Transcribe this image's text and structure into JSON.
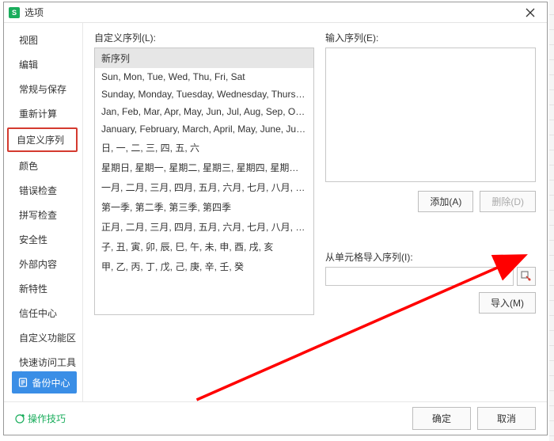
{
  "titlebar": {
    "title": "选项",
    "app_icon_letter": "S"
  },
  "sidebar": {
    "items": [
      {
        "label": "视图"
      },
      {
        "label": "编辑"
      },
      {
        "label": "常规与保存"
      },
      {
        "label": "重新计算"
      },
      {
        "label": "自定义序列"
      },
      {
        "label": "颜色"
      },
      {
        "label": "错误检查"
      },
      {
        "label": "拼写检查"
      },
      {
        "label": "安全性"
      },
      {
        "label": "外部内容"
      },
      {
        "label": "新特性"
      },
      {
        "label": "信任中心"
      },
      {
        "label": "自定义功能区"
      },
      {
        "label": "快速访问工具栏"
      }
    ],
    "selected_index": 4,
    "backup_label": "备份中心"
  },
  "content": {
    "custom_list_label": "自定义序列(L):",
    "custom_list": [
      "新序列",
      "Sun, Mon, Tue, Wed, Thu, Fri, Sat",
      "Sunday, Monday, Tuesday, Wednesday, Thursday, Frid...",
      "Jan, Feb, Mar, Apr, May, Jun, Jul, Aug, Sep, Oct, Nov, ...",
      "January, February, March, April, May, June, July, Augus...",
      "日, 一, 二, 三, 四, 五, 六",
      "星期日, 星期一, 星期二, 星期三, 星期四, 星期五, 星期六",
      "一月, 二月, 三月, 四月, 五月, 六月, 七月, 八月, 九月, 十月, ...",
      "第一季, 第二季, 第三季, 第四季",
      "正月, 二月, 三月, 四月, 五月, 六月, 七月, 八月, 九月, 十月, ...",
      "子, 丑, 寅, 卯, 辰, 巳, 午, 未, 申, 酉, 戌, 亥",
      "甲, 乙, 丙, 丁, 戊, 己, 庚, 辛, 壬, 癸"
    ],
    "custom_list_selected_index": 0,
    "input_label": "输入序列(E):",
    "input_value": "",
    "add_label": "添加(A)",
    "delete_label": "删除(D)",
    "import_label": "从单元格导入序列(I):",
    "import_input_value": "",
    "import_button_label": "导入(M)"
  },
  "footer": {
    "tips_label": "操作技巧",
    "ok_label": "确定",
    "cancel_label": "取消"
  },
  "colors": {
    "accent_green": "#1aad5c",
    "accent_blue": "#3a8ee6",
    "highlight_border": "#d43a2f",
    "arrow_red": "#ff0000"
  }
}
